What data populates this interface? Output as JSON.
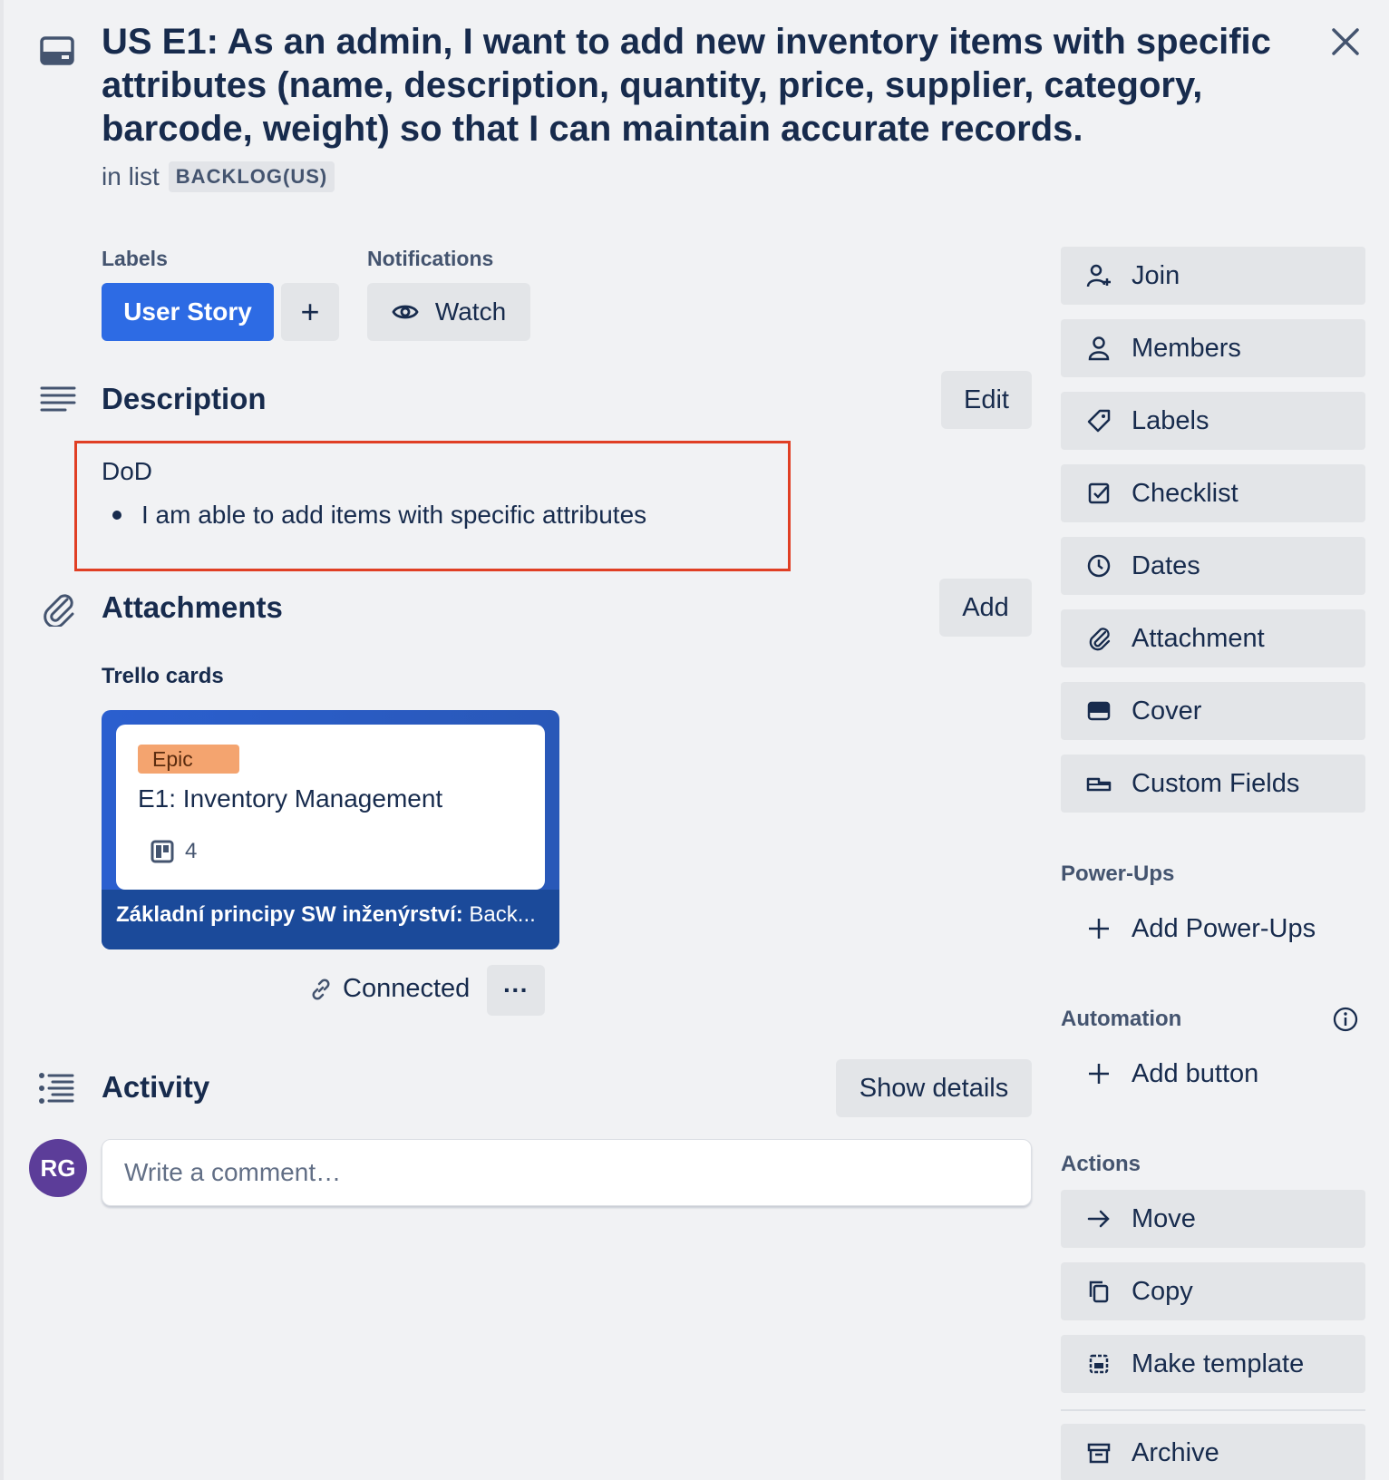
{
  "card": {
    "title": "US E1: As an admin, I want to add new inventory items with specific attributes (name, description, quantity, price, supplier, category, barcode, weight) so that I can maintain accurate records.",
    "in_list_prefix": "in list",
    "list_name": "BACKLOG(US)"
  },
  "labels_section": {
    "heading": "Labels",
    "label": "User Story",
    "label_color": "#2d6be4",
    "add_symbol": "+"
  },
  "notifications": {
    "heading": "Notifications",
    "watch_label": "Watch"
  },
  "description": {
    "heading": "Description",
    "edit_label": "Edit",
    "dod": "DoD",
    "bullets": [
      "I am able to add items with specific attributes"
    ],
    "highlight_color": "#e03f24"
  },
  "attachments": {
    "heading": "Attachments",
    "add_label": "Add",
    "subheading": "Trello cards",
    "linked_card": {
      "label": "Epic",
      "label_color": "#f4a46f",
      "title": "E1: Inventory Management",
      "board_count": "4",
      "board_bold": "Základní principy SW inženýrství:",
      "board_rest": " Back..."
    },
    "connected_label": "Connected",
    "more_label": "···"
  },
  "activity": {
    "heading": "Activity",
    "show_details_label": "Show details",
    "avatar_initials": "RG",
    "avatar_color": "#5c3d99",
    "comment_placeholder": "Write a comment…"
  },
  "sidebar": {
    "card_buttons": [
      {
        "label": "Join",
        "icon": "add-person-icon"
      },
      {
        "label": "Members",
        "icon": "person-icon"
      },
      {
        "label": "Labels",
        "icon": "tag-icon"
      },
      {
        "label": "Checklist",
        "icon": "checklist-icon"
      },
      {
        "label": "Dates",
        "icon": "clock-icon"
      },
      {
        "label": "Attachment",
        "icon": "paperclip-icon"
      },
      {
        "label": "Cover",
        "icon": "cover-icon"
      },
      {
        "label": "Custom Fields",
        "icon": "custom-fields-icon"
      }
    ],
    "powerups": {
      "heading": "Power-Ups",
      "add_label": "Add Power-Ups"
    },
    "automation": {
      "heading": "Automation",
      "add_label": "Add button"
    },
    "actions": {
      "heading": "Actions",
      "items": [
        {
          "label": "Move",
          "icon": "arrow-right-icon"
        },
        {
          "label": "Copy",
          "icon": "copy-icon"
        },
        {
          "label": "Make template",
          "icon": "template-icon"
        },
        {
          "label": "Archive",
          "icon": "archive-icon"
        }
      ]
    }
  }
}
